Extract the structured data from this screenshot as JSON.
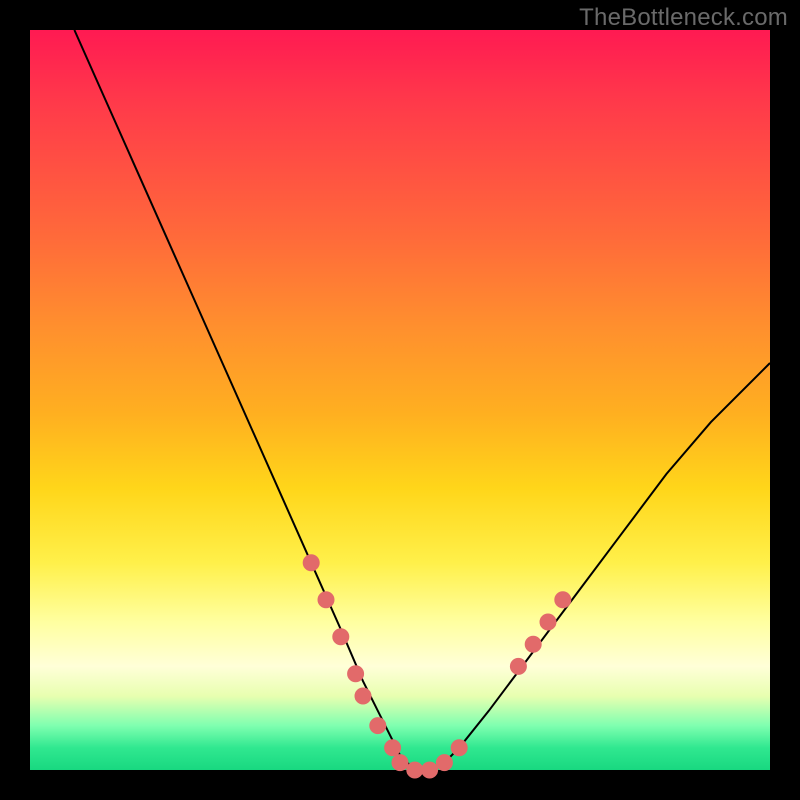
{
  "watermark": "TheBottleneck.com",
  "chart_data": {
    "type": "line",
    "title": "",
    "xlabel": "",
    "ylabel": "",
    "xlim": [
      0,
      100
    ],
    "ylim": [
      0,
      100
    ],
    "grid": false,
    "legend": false,
    "background_gradient": {
      "direction": "vertical",
      "colors_top_to_bottom": [
        "#ff1a52",
        "#ff6a3a",
        "#ffb020",
        "#fff04a",
        "#ffffd8",
        "#30e890"
      ]
    },
    "series": [
      {
        "name": "bottleneck-curve",
        "x": [
          6,
          10,
          14,
          18,
          22,
          26,
          30,
          34,
          38,
          42,
          45,
          48,
          50,
          52,
          54,
          56,
          58,
          62,
          68,
          74,
          80,
          86,
          92,
          98,
          100
        ],
        "values": [
          100,
          91,
          82,
          73,
          64,
          55,
          46,
          37,
          28,
          19,
          12,
          6,
          2,
          0,
          0,
          1,
          3,
          8,
          16,
          24,
          32,
          40,
          47,
          53,
          55
        ]
      }
    ],
    "markers": [
      {
        "x": 38,
        "y": 28
      },
      {
        "x": 40,
        "y": 23
      },
      {
        "x": 42,
        "y": 18
      },
      {
        "x": 44,
        "y": 13
      },
      {
        "x": 45,
        "y": 10
      },
      {
        "x": 47,
        "y": 6
      },
      {
        "x": 49,
        "y": 3
      },
      {
        "x": 50,
        "y": 1
      },
      {
        "x": 52,
        "y": 0
      },
      {
        "x": 54,
        "y": 0
      },
      {
        "x": 56,
        "y": 1
      },
      {
        "x": 58,
        "y": 3
      },
      {
        "x": 66,
        "y": 14
      },
      {
        "x": 68,
        "y": 17
      },
      {
        "x": 70,
        "y": 20
      },
      {
        "x": 72,
        "y": 23
      }
    ],
    "marker_radius": 8
  }
}
